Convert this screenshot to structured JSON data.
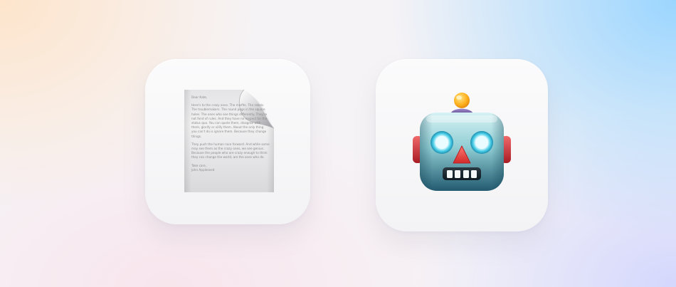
{
  "icons": {
    "document": {
      "icon": "document-icon",
      "letter": {
        "greeting": "Dear Kate,",
        "paragraph_1": "Here's to the crazy ones. The misfits. The rebels. The troublemakers. The round pegs in the square holes. The ones who see things differently. They're not fond of rules. And they have no respect for the status quo. You can quote them, disagree with them, glorify or vilify them. About the only thing you can't do is ignore them. Because they change things.",
        "paragraph_2": "They push the human race forward. And while some may see them as the crazy ones, we see genius. Because the people who are crazy enough to think they can change the world, are the ones who do.",
        "closing": "Take care,",
        "signature": "John Appleseed"
      }
    },
    "robot": {
      "icon": "robot-face-icon"
    }
  }
}
